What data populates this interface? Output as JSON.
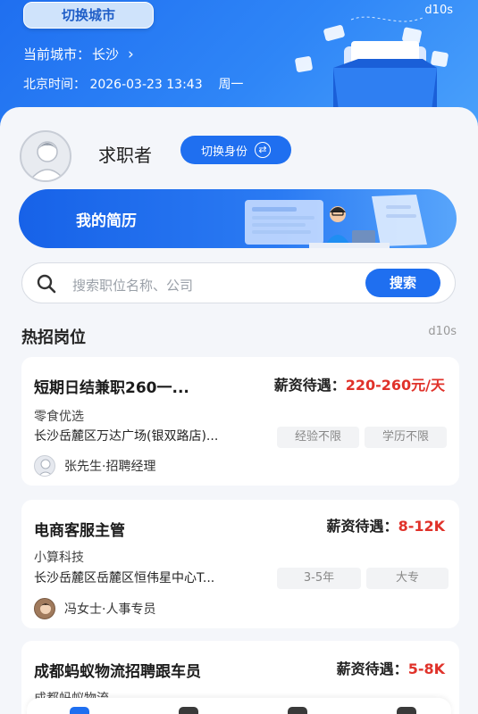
{
  "header": {
    "switch_city_label": "切换城市",
    "corner_code": "d10s",
    "current_city_label": "当前城市：",
    "current_city": "长沙",
    "time_label": "北京时间：",
    "time_value": "2026-03-23 13:43",
    "weekday": "周一"
  },
  "profile": {
    "role": "求职者",
    "switch_role_label": "切换身份"
  },
  "resume": {
    "title": "我的简历"
  },
  "search": {
    "placeholder": "搜索职位名称、公司",
    "button_label": "搜索"
  },
  "section": {
    "title": "热招岗位",
    "code": "d10s"
  },
  "salary_label": "薪资待遇：",
  "jobs": [
    {
      "title": "短期日结兼职260一...",
      "salary": "220-260元/天",
      "company": "零食优选",
      "address": "长沙岳麓区万达广场(银双路店)...",
      "tags": [
        "经验不限",
        "学历不限"
      ],
      "recruiter": "张先生·招聘经理"
    },
    {
      "title": "电商客服主管",
      "salary": "8-12K",
      "company": "小算科技",
      "address": "长沙岳麓区岳麓区恒伟星中心T...",
      "tags": [
        "3-5年",
        "大专"
      ],
      "recruiter": "冯女士·人事专员"
    },
    {
      "title": "成都蚂蚁物流招聘跟车员",
      "salary": "5-8K",
      "company": "成都蚂蚁物流"
    }
  ],
  "colors": {
    "primary": "#1f6ff0",
    "salary": "#e0322a"
  }
}
